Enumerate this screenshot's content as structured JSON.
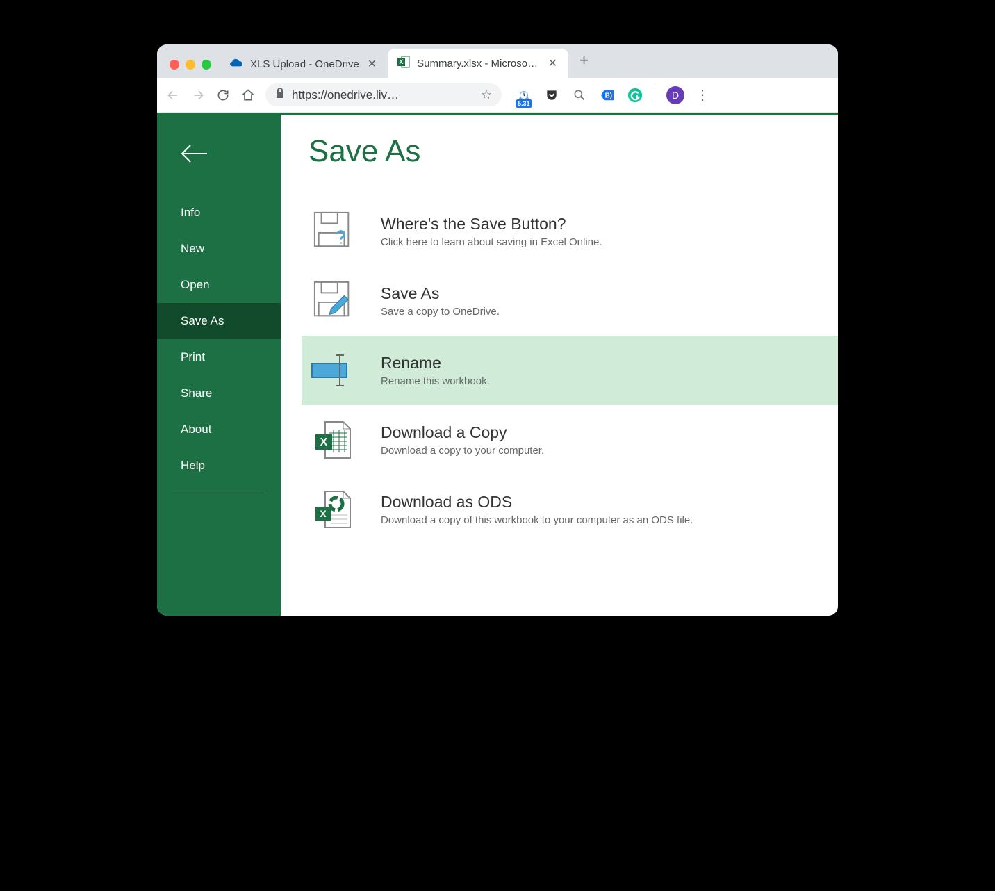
{
  "browser": {
    "tabs": [
      {
        "title": "XLS Upload - OneDrive",
        "active": false
      },
      {
        "title": "Summary.xlsx - Microsoft E",
        "active": true
      }
    ],
    "url": "https://onedrive.liv…",
    "extensions": {
      "badge_value": "5.31",
      "avatar_letter": "D"
    }
  },
  "app": {
    "page_title": "Save As",
    "sidebar": {
      "items": [
        {
          "label": "Info"
        },
        {
          "label": "New"
        },
        {
          "label": "Open"
        },
        {
          "label": "Save As",
          "active": true
        },
        {
          "label": "Print"
        },
        {
          "label": "Share"
        },
        {
          "label": "About"
        },
        {
          "label": "Help"
        }
      ]
    },
    "options": [
      {
        "title": "Where's the Save Button?",
        "desc": "Click here to learn about saving in Excel Online.",
        "icon": "save-question-icon"
      },
      {
        "title": "Save As",
        "desc": "Save a copy to OneDrive.",
        "icon": "save-pencil-icon"
      },
      {
        "title": "Rename",
        "desc": "Rename this workbook.",
        "icon": "rename-icon",
        "highlight": true
      },
      {
        "title": "Download a Copy",
        "desc": "Download a copy to your computer.",
        "icon": "excel-download-icon"
      },
      {
        "title": "Download as ODS",
        "desc": "Download a copy of this workbook to your computer as an ODS file.",
        "icon": "ods-download-icon"
      }
    ]
  }
}
